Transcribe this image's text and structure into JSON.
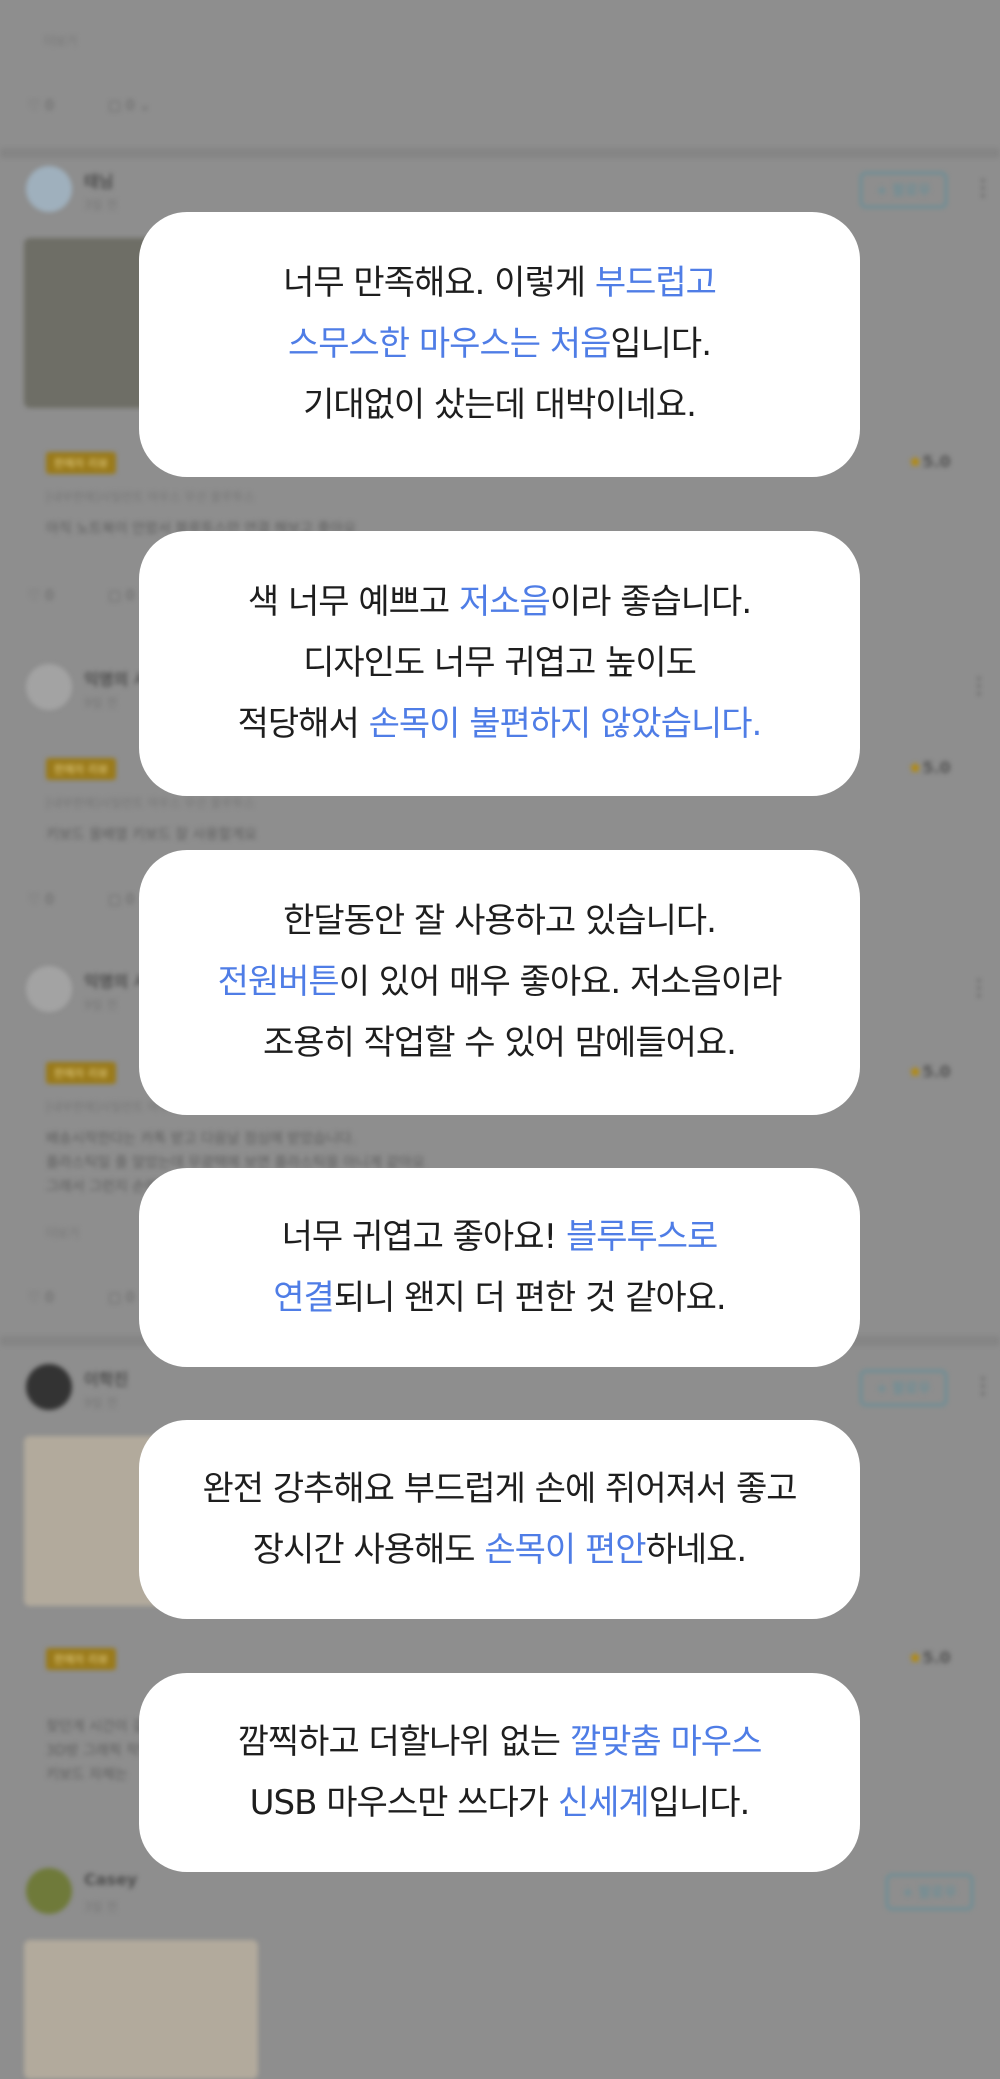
{
  "background": {
    "top_link": "더보기",
    "top_likes": "0",
    "top_comments": "0",
    "reviews": [
      {
        "user": "태님",
        "date": "3일 전",
        "badge": "판매자 리뷰",
        "rating": "5.0",
        "follow": "+ 팔로우",
        "option": "[내부판매]사일런트 마우스 무선 블루투스",
        "text": "아직 노트북이 안왔서 블루투스만 연결 해보고 좋아요",
        "likes": "0",
        "comments": "0"
      },
      {
        "user": "익명의 사용자",
        "date": "9일 전",
        "badge": "판매자 리뷰",
        "rating": "5.0",
        "option": "[내부판매]사일런트 마우스 무선 블루투스",
        "text": "키보드 올배열 키보드 잘 사용할게요",
        "likes": "0",
        "comments": "0"
      },
      {
        "user": "익명의 사용자",
        "date": "9일 전",
        "badge": "판매자 리뷰",
        "rating": "5.0",
        "option": "[내부판매]사일런트 마우스",
        "text1": "배송시작한다는 카톡 받고 다음날 점심에 받았습니다.",
        "text2": "플라스틱일 줄 알았는데 무광택에 보면 플라스틱을 아니게 같아요",
        "text3": "그래서 그런지 손에 닿는 느낌이 고무 포장도 잘 되어 있었고 잘 적고 조용...",
        "more": "더보기",
        "likes": "0",
        "comments": "0"
      },
      {
        "user": "이학진",
        "date": "9일 전",
        "badge": "판매자 리뷰",
        "rating": "5.0",
        "follow": "+ 팔로우",
        "text1": "찾던게 시간이 걸렸는데 너무 좋습니다 만족합니다.",
        "text2": "3D방 그래픽 작업을 하는데 훌륭하네요 마스...",
        "text3": "키보드 자체는"
      },
      {
        "user": "Casey",
        "date": "3일 전",
        "follow": "+ 팔로우"
      }
    ]
  },
  "cards": [
    {
      "lines": [
        [
          {
            "t": "너무 만족해요. 이렇게 ",
            "h": false
          },
          {
            "t": "부드럽고",
            "h": true
          }
        ],
        [
          {
            "t": "스무스한 마우스는 처음",
            "h": true
          },
          {
            "t": "입니다.",
            "h": false
          }
        ],
        [
          {
            "t": "기대없이 샀는데 대박이네요.",
            "h": false
          }
        ]
      ]
    },
    {
      "lines": [
        [
          {
            "t": "색 너무 예쁘고 ",
            "h": false
          },
          {
            "t": "저소음",
            "h": true
          },
          {
            "t": "이라 좋습니다.",
            "h": false
          }
        ],
        [
          {
            "t": "디자인도 너무 귀엽고 높이도",
            "h": false
          }
        ],
        [
          {
            "t": "적당해서 ",
            "h": false
          },
          {
            "t": "손목이 불편하지 않았습니다.",
            "h": true
          }
        ]
      ]
    },
    {
      "lines": [
        [
          {
            "t": "한달동안 잘 사용하고 있습니다.",
            "h": false
          }
        ],
        [
          {
            "t": "전원버튼",
            "h": true
          },
          {
            "t": "이 있어 매우 좋아요. 저소음이라",
            "h": false
          }
        ],
        [
          {
            "t": "조용히 작업할 수 있어 맘에들어요.",
            "h": false
          }
        ]
      ]
    },
    {
      "lines": [
        [
          {
            "t": "너무 귀엽고 좋아요! ",
            "h": false
          },
          {
            "t": "블루투스로",
            "h": true
          }
        ],
        [
          {
            "t": "연결",
            "h": true
          },
          {
            "t": "되니 왠지 더 편한 것 같아요.",
            "h": false
          }
        ]
      ]
    },
    {
      "lines": [
        [
          {
            "t": "완전 강추해요 부드럽게 손에 쥐어져서 좋고",
            "h": false
          }
        ],
        [
          {
            "t": "장시간 사용해도 ",
            "h": false
          },
          {
            "t": "손목이 편안",
            "h": true
          },
          {
            "t": "하네요.",
            "h": false
          }
        ]
      ]
    },
    {
      "lines": [
        [
          {
            "t": "깜찍하고 더할나위 없는 ",
            "h": false
          },
          {
            "t": "깔맞춤 마우스",
            "h": true
          }
        ],
        [
          {
            "t": "USB 마우스만 쓰다가 ",
            "h": false
          },
          {
            "t": "신세계",
            "h": true
          },
          {
            "t": "입니다.",
            "h": false
          }
        ]
      ]
    }
  ],
  "colors": {
    "highlight": "#4f7de6",
    "card_bg": "#ffffff",
    "overlay_bg": "#8e8e8e"
  }
}
